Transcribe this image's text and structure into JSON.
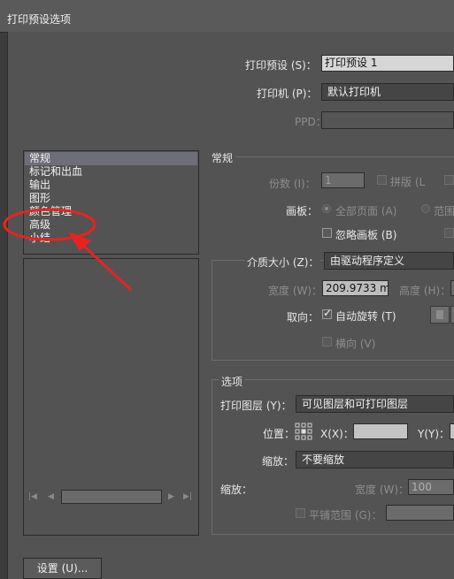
{
  "window": {
    "title": "打印预设选项"
  },
  "header": {
    "preset_label": "打印预设 (S)：",
    "preset_value": "打印预设 1",
    "printer_label": "打印机 (P)：",
    "printer_value": "默认打印机",
    "ppd_label": "PPD："
  },
  "sidebar": {
    "items": [
      {
        "label": "常规",
        "selected": true
      },
      {
        "label": "标记和出血"
      },
      {
        "label": "输出"
      },
      {
        "label": "图形"
      },
      {
        "label": "颜色管理"
      },
      {
        "label": "高级"
      },
      {
        "label": "小结"
      }
    ]
  },
  "general": {
    "section_title": "常规",
    "copies_label": "份数 (I)：",
    "copies_value": "1",
    "collate_label": "拼版 (L",
    "artboard_label": "画板：",
    "all_pages_label": "全部页面 (A)",
    "range_label": "范围",
    "ignore_artboards_label": "忽略画板 (B)"
  },
  "media": {
    "size_label": "介质大小 (Z)：",
    "size_value": "由驱动程序定义",
    "width_label": "宽度 (W)：",
    "width_value": "209.9733 m",
    "height_label": "高度 (H)：",
    "orientation_label": "取向：",
    "auto_rotate_label": "自动旋转 (T)",
    "auto_rotate_checked": true,
    "landscape_label": "横向 (V)"
  },
  "options": {
    "section_title": "选项",
    "print_layers_label": "打印图层 (Y)：",
    "print_layers_value": "可见图层和可打印图层",
    "position_label": "位置：",
    "x_label": "X(X)：",
    "y_label": "Y(Y)：",
    "scaling_label": "缩放：",
    "scaling_value": "不要缩放",
    "scale_label": "缩放：",
    "scale_width_label": "宽度 (W)：",
    "scale_width_value": "100",
    "tile_range_label": "平铺范围 (G)："
  },
  "footer": {
    "setup_button": "设置 (U)..."
  },
  "annotation": {
    "color": "#e8231f"
  }
}
